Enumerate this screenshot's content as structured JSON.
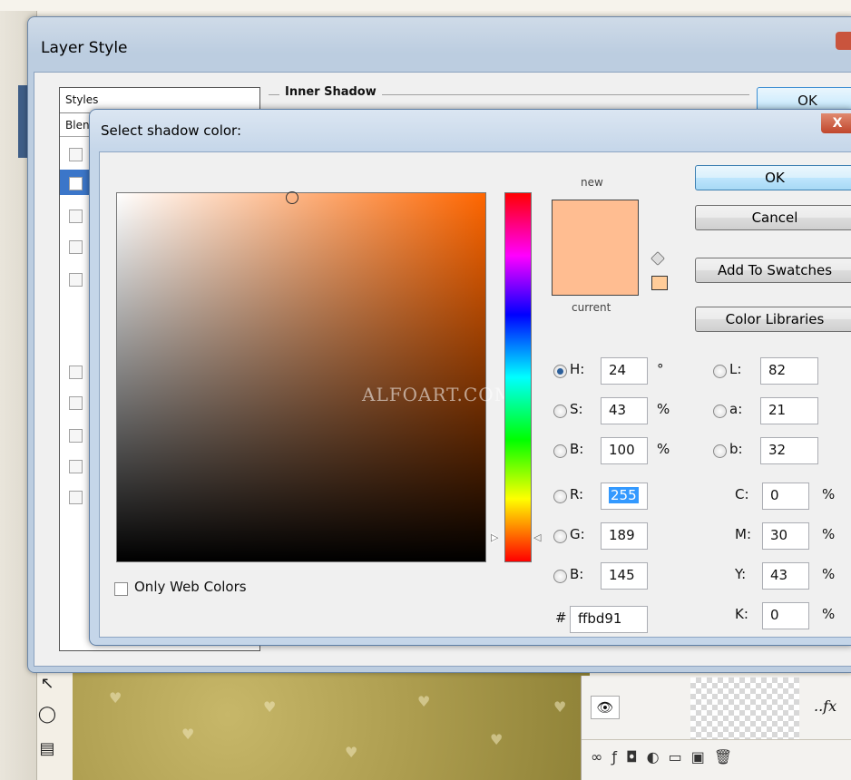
{
  "layer_style": {
    "title": "Layer Style",
    "styles_header": "Styles",
    "blend_row": "Blen",
    "group_title": "Inner Shadow",
    "ok_label": "OK"
  },
  "picker": {
    "title": "Select shadow color:",
    "close_label": "X",
    "watermark": "ALFOART.COM",
    "new_label": "new",
    "current_label": "current",
    "new_color": "#ffbd91",
    "current_color": "#ffbd91",
    "websafe_color": "#ffcc99",
    "buttons": {
      "ok": "OK",
      "cancel": "Cancel",
      "add_to_swatches": "Add To Swatches",
      "color_libraries": "Color Libraries"
    },
    "hsb": {
      "h": {
        "label": "H:",
        "value": "24",
        "unit": "°"
      },
      "s": {
        "label": "S:",
        "value": "43",
        "unit": "%"
      },
      "b": {
        "label": "B:",
        "value": "100",
        "unit": "%"
      }
    },
    "rgb": {
      "r": {
        "label": "R:",
        "value": "255"
      },
      "g": {
        "label": "G:",
        "value": "189"
      },
      "b": {
        "label": "B:",
        "value": "145"
      }
    },
    "lab": {
      "l": {
        "label": "L:",
        "value": "82"
      },
      "a": {
        "label": "a:",
        "value": "21"
      },
      "b": {
        "label": "b:",
        "value": "32"
      }
    },
    "cmyk": {
      "c": {
        "label": "C:",
        "value": "0",
        "unit": "%"
      },
      "m": {
        "label": "M:",
        "value": "30",
        "unit": "%"
      },
      "y": {
        "label": "Y:",
        "value": "43",
        "unit": "%"
      },
      "k": {
        "label": "K:",
        "value": "0",
        "unit": "%"
      }
    },
    "hex": {
      "label": "#",
      "value": "ffbd91"
    },
    "only_web_colors": "Only Web Colors",
    "selected_model": "H"
  },
  "layers_panel": {
    "fx_label": "..fx",
    "footer_icons": [
      "link-icon",
      "fx-icon",
      "mask-icon",
      "adjustment-icon",
      "folder-icon",
      "new-layer-icon",
      "trash-icon"
    ]
  }
}
